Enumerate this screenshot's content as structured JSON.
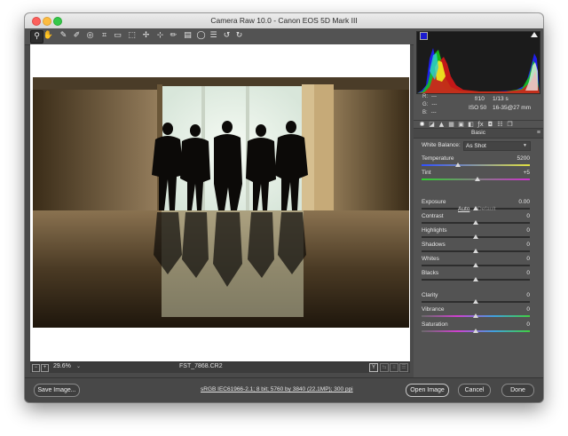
{
  "window": {
    "title": "Camera Raw 10.0  -  Canon EOS 5D Mark III"
  },
  "toolbar": {
    "tools": [
      {
        "name": "zoom-tool",
        "icon": "magnifier-icon",
        "glyph": "⚲"
      },
      {
        "name": "hand-tool",
        "icon": "hand-icon",
        "glyph": "✋"
      },
      {
        "name": "white-balance-tool",
        "icon": "eyedropper-icon",
        "glyph": "✎"
      },
      {
        "name": "color-sampler-tool",
        "icon": "eyedropper-plus-icon",
        "glyph": "✐"
      },
      {
        "name": "targeted-adjustment-tool",
        "icon": "target-icon",
        "glyph": "◎"
      },
      {
        "name": "crop-tool",
        "icon": "crop-icon",
        "glyph": "⌗"
      },
      {
        "name": "straighten-tool",
        "icon": "level-icon",
        "glyph": "▭"
      },
      {
        "name": "transform-tool",
        "icon": "transform-icon",
        "glyph": "⬚"
      },
      {
        "name": "spot-removal-tool",
        "icon": "brush-icon",
        "glyph": "✢"
      },
      {
        "name": "red-eye-tool",
        "icon": "eye-icon",
        "glyph": "⊹"
      },
      {
        "name": "adjustment-brush-tool",
        "icon": "paintbrush-icon",
        "glyph": "✏"
      },
      {
        "name": "graduated-filter-tool",
        "icon": "gradient-icon",
        "glyph": "▤"
      },
      {
        "name": "radial-filter-tool",
        "icon": "ellipse-icon",
        "glyph": "◯"
      },
      {
        "name": "preferences-button",
        "icon": "list-icon",
        "glyph": "☰"
      },
      {
        "name": "rotate-left-button",
        "icon": "rotate-left-icon",
        "glyph": "↺"
      },
      {
        "name": "rotate-right-button",
        "icon": "rotate-right-icon",
        "glyph": "↻"
      }
    ],
    "fullscreen_icon": "⇱"
  },
  "status": {
    "zoom_out_label": "−",
    "zoom_in_label": "+",
    "zoom": "29.6%",
    "zoom_arrow": "⌄",
    "filename": "FST_7868.CR2",
    "compare_labels": [
      "Y",
      "⇆",
      "≡",
      "☰"
    ]
  },
  "histogram": {
    "colors": {
      "red": "#e01818",
      "green": "#18d018",
      "blue": "#2020ff",
      "yellow": "#f0f020",
      "cyan": "#30d0d0",
      "white": "#f0f0f0"
    }
  },
  "readout": {
    "r_label": "R:",
    "r_value": "---",
    "g_label": "G:",
    "g_value": "---",
    "b_label": "B:",
    "b_value": "---",
    "aperture": "f/10",
    "shutter": "1/13 s",
    "iso": "ISO 50",
    "lens": "16-35@27 mm"
  },
  "panel_tabs": [
    {
      "name": "tab-basic",
      "icon": "aperture-icon",
      "glyph": "✺"
    },
    {
      "name": "tab-tone-curve",
      "icon": "curve-icon",
      "glyph": "◪"
    },
    {
      "name": "tab-detail",
      "icon": "mountain-icon",
      "glyph": "▲"
    },
    {
      "name": "tab-hsl",
      "icon": "hsl-icon",
      "glyph": "▦"
    },
    {
      "name": "tab-split-toning",
      "icon": "split-icon",
      "glyph": "▣"
    },
    {
      "name": "tab-lens",
      "icon": "lens-icon",
      "glyph": "◧"
    },
    {
      "name": "tab-effects",
      "icon": "fx-icon",
      "glyph": "ƒx"
    },
    {
      "name": "tab-camera-calibration",
      "icon": "camera-icon",
      "glyph": "◘"
    },
    {
      "name": "tab-presets",
      "icon": "sliders-icon",
      "glyph": "☷"
    },
    {
      "name": "tab-snapshots",
      "icon": "snapshot-icon",
      "glyph": "❐"
    }
  ],
  "basic": {
    "title": "Basic",
    "menu_icon": "≡",
    "white_balance_label": "White Balance:",
    "white_balance_value": "As Shot",
    "dropdown_icon": "▼",
    "auto_label": "Auto",
    "default_label": "Default",
    "sliders": [
      {
        "key": "temperature",
        "label": "Temperature",
        "value": "5200",
        "position": 0.34
      },
      {
        "key": "tint",
        "label": "Tint",
        "value": "+5",
        "position": 0.52
      },
      {
        "key": "exposure",
        "label": "Exposure",
        "value": "0.00",
        "position": 0.5
      },
      {
        "key": "contrast",
        "label": "Contrast",
        "value": "0",
        "position": 0.5
      },
      {
        "key": "highlights",
        "label": "Highlights",
        "value": "0",
        "position": 0.5
      },
      {
        "key": "shadows",
        "label": "Shadows",
        "value": "0",
        "position": 0.5
      },
      {
        "key": "whites",
        "label": "Whites",
        "value": "0",
        "position": 0.5
      },
      {
        "key": "blacks",
        "label": "Blacks",
        "value": "0",
        "position": 0.5
      },
      {
        "key": "clarity",
        "label": "Clarity",
        "value": "0",
        "position": 0.5
      },
      {
        "key": "vibrance",
        "label": "Vibrance",
        "value": "0",
        "position": 0.5
      },
      {
        "key": "saturation",
        "label": "Saturation",
        "value": "0",
        "position": 0.5
      }
    ]
  },
  "footer": {
    "save_label": "Save Image...",
    "workflow_info": "sRGB IEC61966-2.1; 8 bit; 5760 by 3840 (22.1MP); 300 ppi",
    "open_label": "Open Image",
    "cancel_label": "Cancel",
    "done_label": "Done"
  }
}
